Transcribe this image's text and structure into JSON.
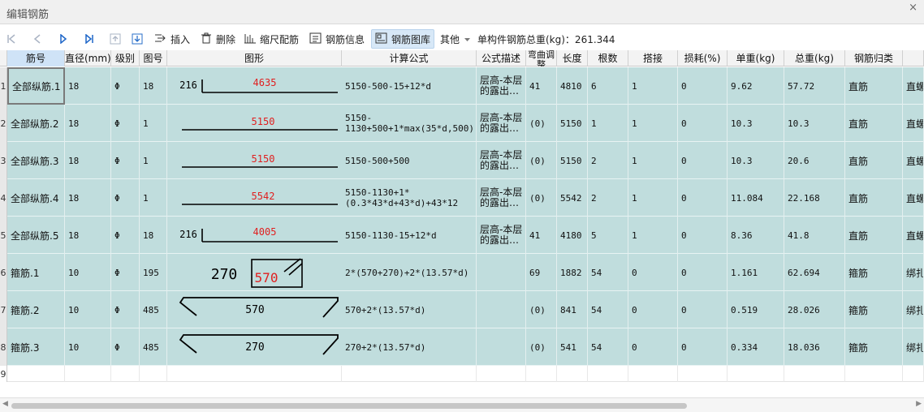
{
  "window": {
    "title": "编辑钢筋",
    "close_glyph": "×"
  },
  "toolbar": {
    "insert_label": "插入",
    "delete_label": "删除",
    "scale_rebar_label": "缩尺配筋",
    "rebar_info_label": "钢筋信息",
    "rebar_library_label": "钢筋图库",
    "other_label": "其他",
    "total_weight_label": "单构件钢筋总重(kg)：261.344"
  },
  "headers": [
    "筋号",
    "直径(mm)",
    "级别",
    "图号",
    "图形",
    "计算公式",
    "公式描述",
    "弯曲调整",
    "长度",
    "根数",
    "搭接",
    "损耗(%)",
    "单重(kg)",
    "总重(kg)",
    "钢筋归类",
    ""
  ],
  "rows": [
    {
      "num": "1",
      "name": "全部纵筋.1",
      "dia": "18",
      "grade": "Φ",
      "fig": "18",
      "formula": "5150-500-15+12*d",
      "desc": "层高-本层的露出…",
      "bend": "41",
      "len": "4810",
      "count": "6",
      "lap": "1",
      "loss": "0",
      "unit": "9.62",
      "total": "57.72",
      "cls": "直筋",
      "extra": "直螺",
      "shape": {
        "left": "216",
        "mid": "4635"
      }
    },
    {
      "num": "2",
      "name": "全部纵筋.2",
      "dia": "18",
      "grade": "Φ",
      "fig": "1",
      "formula": "5150-1130+500+1*max(35*d,500)",
      "desc": "层高-本层的露出…",
      "bend": "(0)",
      "len": "5150",
      "count": "1",
      "lap": "1",
      "loss": "0",
      "unit": "10.3",
      "total": "10.3",
      "cls": "直筋",
      "extra": "直螺",
      "shape": {
        "mid": "5150"
      }
    },
    {
      "num": "3",
      "name": "全部纵筋.3",
      "dia": "18",
      "grade": "Φ",
      "fig": "1",
      "formula": "5150-500+500",
      "desc": "层高-本层的露出…",
      "bend": "(0)",
      "len": "5150",
      "count": "2",
      "lap": "1",
      "loss": "0",
      "unit": "10.3",
      "total": "20.6",
      "cls": "直筋",
      "extra": "直螺",
      "shape": {
        "mid": "5150"
      }
    },
    {
      "num": "4",
      "name": "全部纵筋.4",
      "dia": "18",
      "grade": "Φ",
      "fig": "1",
      "formula": "5150-1130+1*(0.3*43*d+43*d)+43*12",
      "desc": "层高-本层的露出…",
      "bend": "(0)",
      "len": "5542",
      "count": "2",
      "lap": "1",
      "loss": "0",
      "unit": "11.084",
      "total": "22.168",
      "cls": "直筋",
      "extra": "直螺",
      "shape": {
        "mid": "5542"
      }
    },
    {
      "num": "5",
      "name": "全部纵筋.5",
      "dia": "18",
      "grade": "Φ",
      "fig": "18",
      "formula": "5150-1130-15+12*d",
      "desc": "层高-本层的露出…",
      "bend": "41",
      "len": "4180",
      "count": "5",
      "lap": "1",
      "loss": "0",
      "unit": "8.36",
      "total": "41.8",
      "cls": "直筋",
      "extra": "直螺",
      "shape": {
        "left": "216",
        "mid": "4005"
      }
    },
    {
      "num": "6",
      "name": "箍筋.1",
      "dia": "10",
      "grade": "Φ",
      "fig": "195",
      "formula": "2*(570+270)+2*(13.57*d)",
      "desc": "",
      "bend": "69",
      "len": "1882",
      "count": "54",
      "lap": "0",
      "loss": "0",
      "unit": "1.161",
      "total": "62.694",
      "cls": "箍筋",
      "extra": "绑扎",
      "shape": {
        "left": "270",
        "mid": "570"
      }
    },
    {
      "num": "7",
      "name": "箍筋.2",
      "dia": "10",
      "grade": "Φ",
      "fig": "485",
      "formula": "570+2*(13.57*d)",
      "desc": "",
      "bend": "(0)",
      "len": "841",
      "count": "54",
      "lap": "0",
      "loss": "0",
      "unit": "0.519",
      "total": "28.026",
      "cls": "箍筋",
      "extra": "绑扎",
      "shape": {
        "mid": "570"
      }
    },
    {
      "num": "8",
      "name": "箍筋.3",
      "dia": "10",
      "grade": "Φ",
      "fig": "485",
      "formula": "270+2*(13.57*d)",
      "desc": "",
      "bend": "(0)",
      "len": "541",
      "count": "54",
      "lap": "0",
      "loss": "0",
      "unit": "0.334",
      "total": "18.036",
      "cls": "箍筋",
      "extra": "绑扎",
      "shape": {
        "mid": "270"
      }
    }
  ],
  "empty_row_num": "9",
  "colors": {
    "row_bg": "#c0dddd",
    "dim_red": "#e02020",
    "selected_header": "#cfe3f7"
  }
}
